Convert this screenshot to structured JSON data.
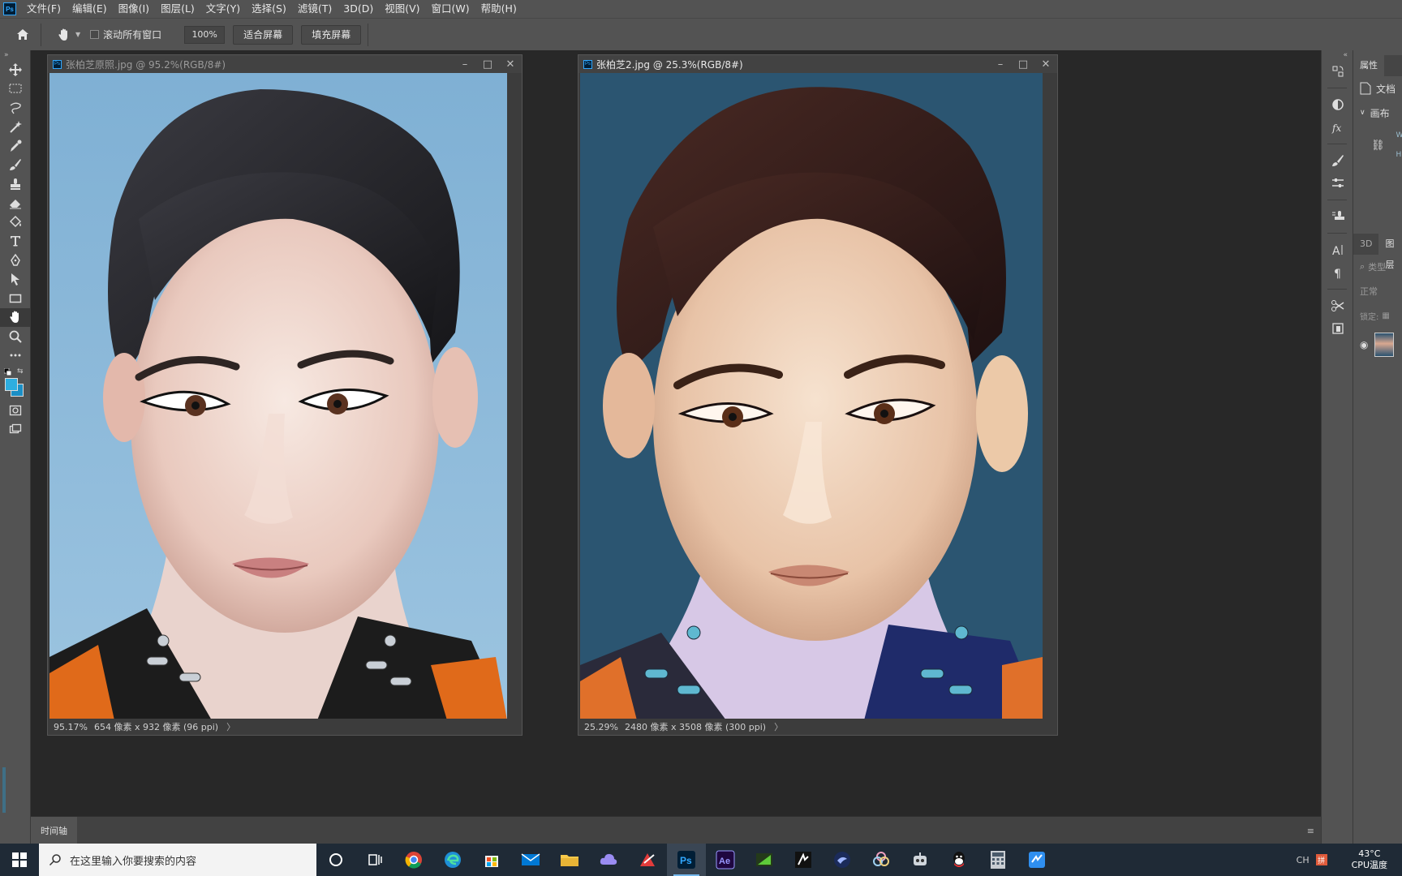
{
  "menu": {
    "items": [
      "文件(F)",
      "编辑(E)",
      "图像(I)",
      "图层(L)",
      "文字(Y)",
      "选择(S)",
      "滤镜(T)",
      "3D(D)",
      "视图(V)",
      "窗口(W)",
      "帮助(H)"
    ]
  },
  "options": {
    "scroll_all_label": "滚动所有窗口",
    "zoom_value": "100%",
    "fit_screen": "适合屏幕",
    "fill_screen": "填充屏幕"
  },
  "colors": {
    "foreground": "#2eaee0",
    "background": "#1b8fc6",
    "ps_accent": "#31a8ff"
  },
  "doc1": {
    "title": "张柏芝原照.jpg @ 95.2%(RGB/8#)",
    "zoom": "95.17%",
    "info": "654 像素 x 932 像素 (96 ppi)",
    "arrow": "〉",
    "active": false
  },
  "doc2": {
    "title": "张柏芝2.jpg @ 25.3%(RGB/8#)",
    "zoom": "25.29%",
    "info": "2480 像素 x 3508 像素 (300 ppi)",
    "arrow": "〉",
    "active": true
  },
  "panels": {
    "properties_tab": "属性",
    "doc_label": "文档",
    "canvas_label": "画布",
    "w": "W",
    "h": "H",
    "tab_3d": "3D",
    "tab_layers": "图层",
    "search_placeholder": "类型",
    "blend_mode": "正常",
    "lock_label": "锁定:"
  },
  "timeline": {
    "tab": "时间轴"
  },
  "taskbar": {
    "search_placeholder": "在这里输入你要搜索的内容",
    "ime": "CH",
    "ime2": "拼",
    "temp": "43°C",
    "temp_label": "CPU温度",
    "apps": [
      "cortana-icon",
      "task-view-icon",
      "chrome-icon",
      "edge-icon",
      "store-icon",
      "mail-icon",
      "explorer-icon",
      "cloud-icon",
      "red-app-icon",
      "photoshop-icon",
      "after-effects-icon",
      "green-app-icon",
      "dark-app-icon",
      "bird-app-icon",
      "flower-app-icon",
      "robot-app-icon",
      "qq-icon",
      "calculator-icon",
      "blue-app-icon"
    ]
  }
}
